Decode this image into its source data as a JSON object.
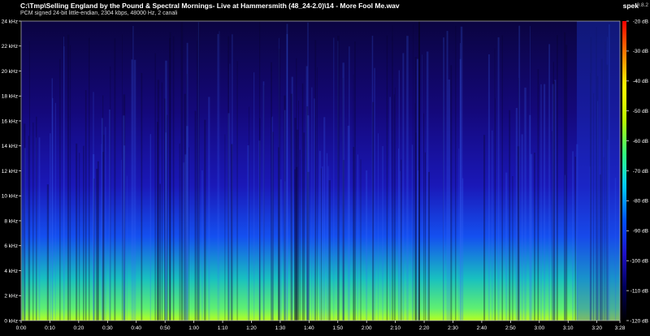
{
  "window": {
    "title": "C:\\Tmp\\Selling England by the Pound & Spectral Mornings- Live at Hammersmith (48_24-2.0)\\14 - More Fool Me.wav",
    "subtitle": "PCM signed 24-bit little-endian, 2304 kbps, 48000 Hz, 2 canali",
    "app_name": "spek",
    "app_version": "0.8.2"
  },
  "chart_data": {
    "type": "heatmap",
    "x_ticks": [
      "0:00",
      "0:10",
      "0:20",
      "0:30",
      "0:40",
      "0:50",
      "1:00",
      "1:10",
      "1:20",
      "1:30",
      "1:40",
      "1:50",
      "2:00",
      "2:10",
      "2:20",
      "2:30",
      "2:40",
      "2:50",
      "3:00",
      "3:10",
      "3:20",
      "3:28"
    ],
    "x_values_sec": [
      0,
      10,
      20,
      30,
      40,
      50,
      60,
      70,
      80,
      90,
      100,
      110,
      120,
      130,
      140,
      150,
      160,
      170,
      180,
      190,
      200,
      208
    ],
    "xlim_sec": [
      0,
      208
    ],
    "y_ticks": [
      "0 kHz",
      "2 kHz",
      "4 kHz",
      "6 kHz",
      "8 kHz",
      "10 kHz",
      "12 kHz",
      "14 kHz",
      "16 kHz",
      "18 kHz",
      "20 kHz",
      "22 kHz",
      "24 kHz"
    ],
    "y_values_khz": [
      0,
      2,
      4,
      6,
      8,
      10,
      12,
      14,
      16,
      18,
      20,
      22,
      24
    ],
    "ylim_khz": [
      0,
      24
    ],
    "colorbar_ticks": [
      "-120 dB",
      "-110 dB",
      "-100 dB",
      "-90 dB",
      "-80 dB",
      "-70 dB",
      "-60 dB",
      "-50 dB",
      "-40 dB",
      "-30 dB",
      "-20 dB"
    ],
    "colorbar_values_db": [
      -120,
      -110,
      -100,
      -90,
      -80,
      -70,
      -60,
      -50,
      -40,
      -30,
      -20
    ],
    "colorbar_range_db": [
      -120,
      -20
    ],
    "colormap": [
      "#000000",
      "#00005a",
      "#1e10c8",
      "#0050ff",
      "#00c8ff",
      "#30ff80",
      "#b8ff00",
      "#ffff00",
      "#ff8000",
      "#ff0000"
    ]
  }
}
